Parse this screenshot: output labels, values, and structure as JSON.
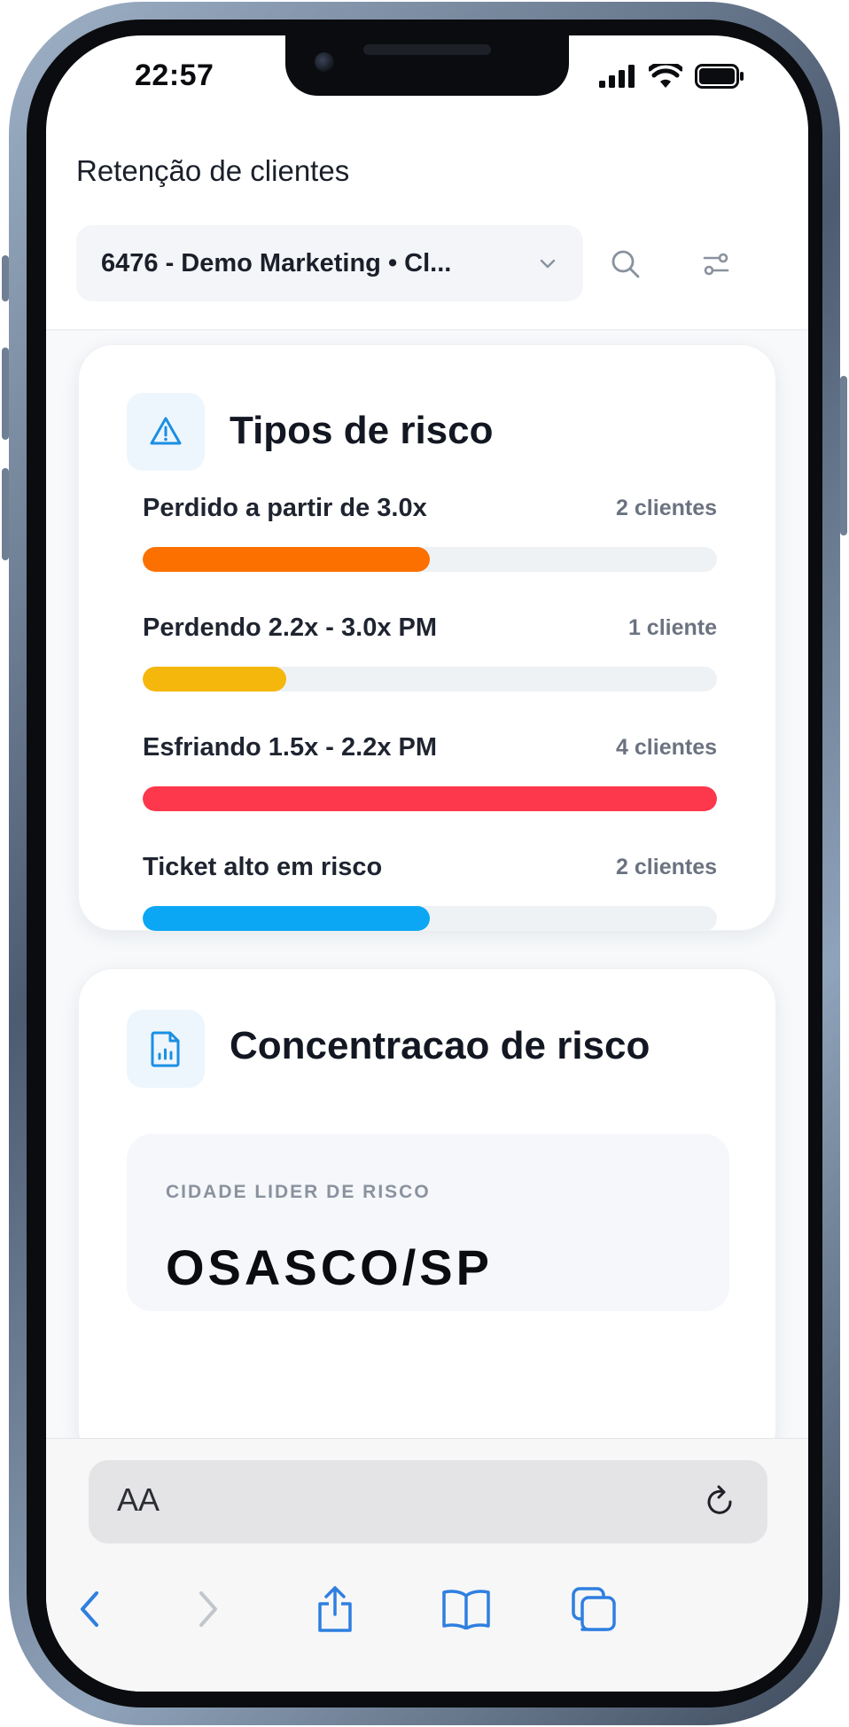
{
  "status_bar": {
    "time": "22:57"
  },
  "header": {
    "title": "Retenção de clientes",
    "selector_value": "6476 - Demo Marketing • Cl..."
  },
  "risk_types": {
    "title": "Tipos de risco",
    "items": [
      {
        "label": "Perdido a partir de 3.0x",
        "count": "2 clientes",
        "fraction": 0.5,
        "color": "#fc7000"
      },
      {
        "label": "Perdendo 2.2x - 3.0x PM",
        "count": "1 cliente",
        "fraction": 0.25,
        "color": "#f6b70d"
      },
      {
        "label": "Esfriando 1.5x - 2.2x PM",
        "count": "4 clientes",
        "fraction": 1.0,
        "color": "#fd374c"
      },
      {
        "label": "Ticket alto em risco",
        "count": "2 clientes",
        "fraction": 0.5,
        "color": "#0ba7f4"
      }
    ]
  },
  "risk_concentration": {
    "title": "Concentracao de risco",
    "label": "CIDADE LIDER DE RISCO",
    "value": "OSASCO/SP"
  },
  "browser": {
    "text_size_label": "AA",
    "icons": [
      "reload-icon",
      "back-icon",
      "forward-icon",
      "share-icon",
      "bookmarks-icon",
      "tabs-icon"
    ]
  },
  "colors": {
    "accent_blue": "#1a8fe3",
    "ios_blue": "#2f7fe0"
  }
}
